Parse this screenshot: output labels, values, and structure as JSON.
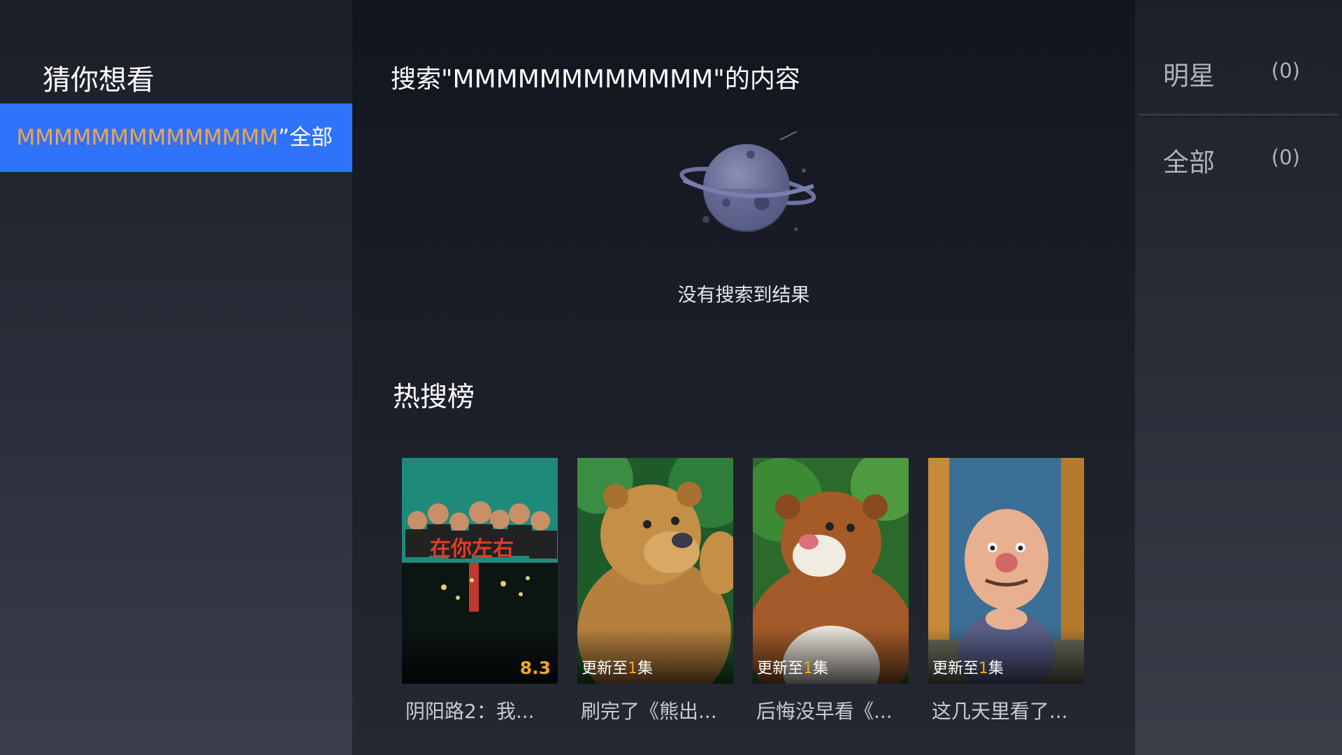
{
  "left": {
    "title": "猜你想看",
    "suggestion": {
      "query": "MMMMMMMMMMMMMM",
      "suffix": "”全部"
    }
  },
  "center": {
    "heading": "搜索\"MMMMMMMMMMMM\"的内容",
    "empty_text": "没有搜索到结果",
    "hot_title": "热搜榜",
    "cards": [
      {
        "caption": "阴阳路2：我...",
        "score": "8.3"
      },
      {
        "caption": "刷完了《熊出...",
        "update_prefix": "更新至",
        "update_num": "1",
        "update_suffix": "集"
      },
      {
        "caption": "后悔没早看《...",
        "update_prefix": "更新至",
        "update_num": "1",
        "update_suffix": "集"
      },
      {
        "caption": "这几天里看了...",
        "update_prefix": "更新至",
        "update_num": "1",
        "update_suffix": "集"
      }
    ]
  },
  "right": {
    "tabs": [
      {
        "label": "明星",
        "count": "(0)"
      },
      {
        "label": "全部",
        "count": "(0)"
      }
    ]
  },
  "colors": {
    "accent_blue": "#2f73fa",
    "highlight_orange": "#f5a623"
  }
}
